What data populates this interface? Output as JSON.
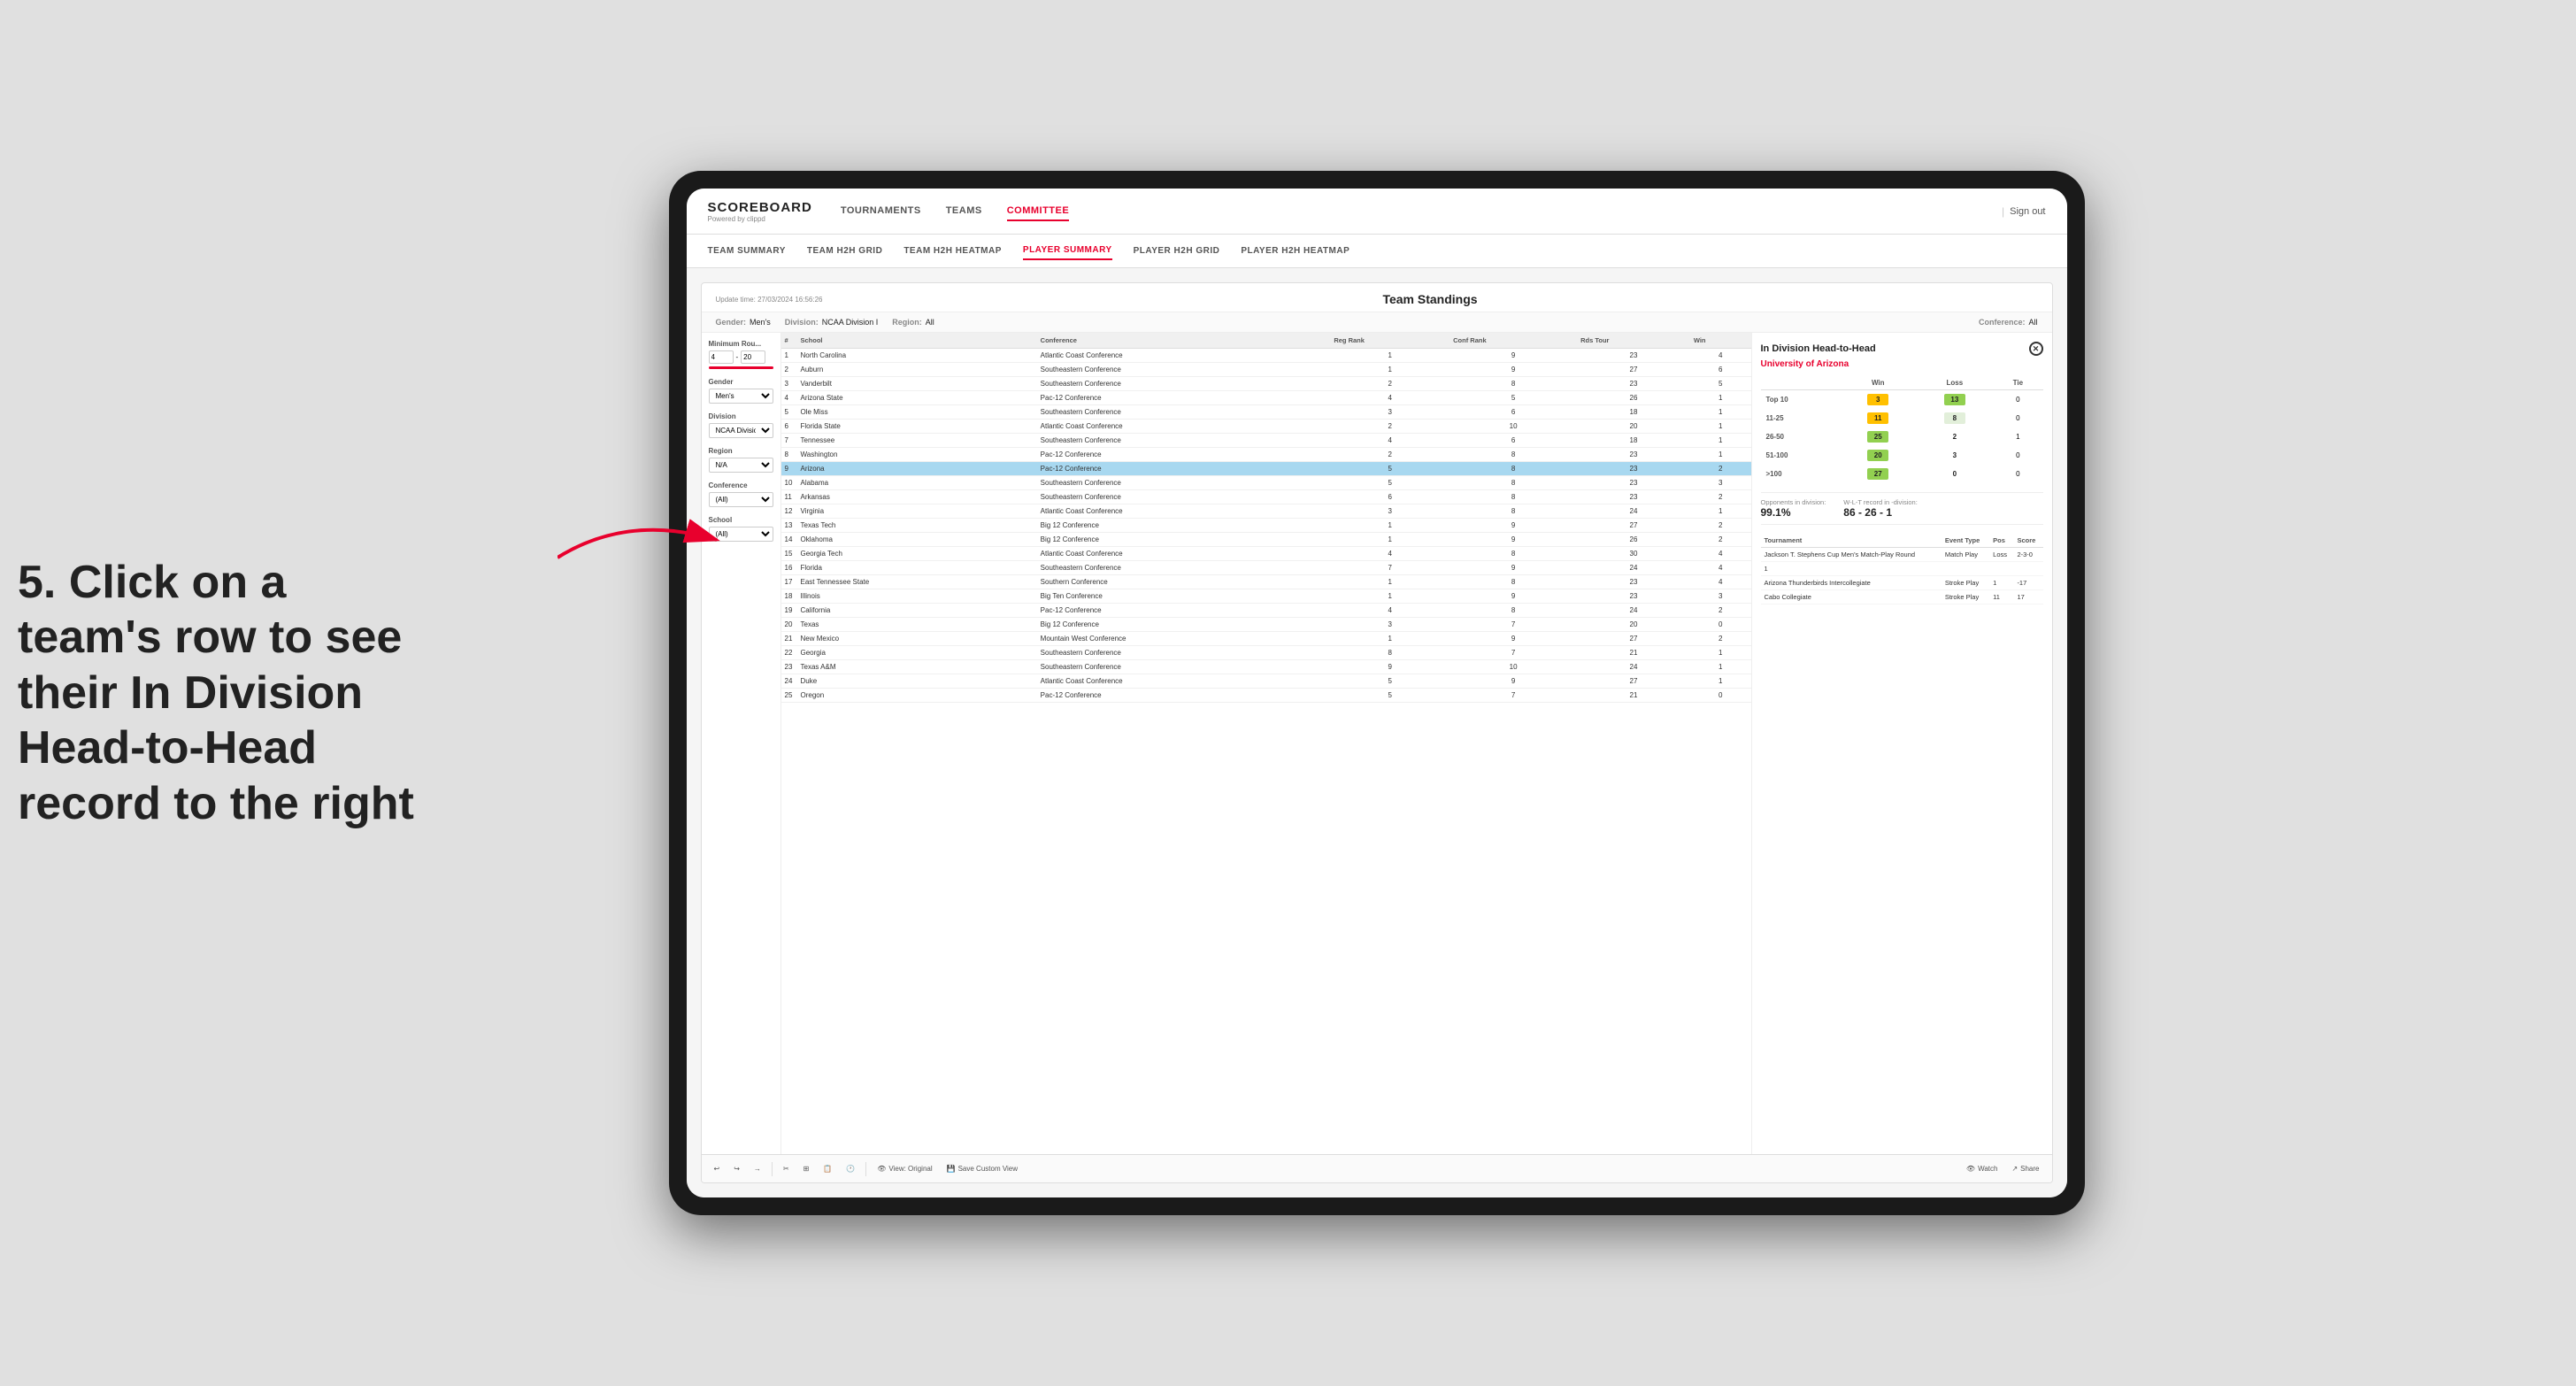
{
  "page": {
    "background_color": "#e0e0e0"
  },
  "annotation": {
    "text": "5. Click on a team's row to see their In Division Head-to-Head record to the right"
  },
  "top_nav": {
    "logo": "SCOREBOARD",
    "logo_sub": "Powered by clippd",
    "links": [
      "TOURNAMENTS",
      "TEAMS",
      "COMMITTEE"
    ],
    "active_link": "COMMITTEE",
    "sign_out": "Sign out"
  },
  "sub_nav": {
    "links": [
      "TEAM SUMMARY",
      "TEAM H2H GRID",
      "TEAM H2H HEATMAP",
      "PLAYER SUMMARY",
      "PLAYER H2H GRID",
      "PLAYER H2H HEATMAP"
    ],
    "active_link": "PLAYER SUMMARY"
  },
  "panel": {
    "title": "Team Standings",
    "update_time": "Update time:",
    "update_date": "27/03/2024 16:56:26",
    "filters": {
      "gender_label": "Gender:",
      "gender_value": "Men's",
      "division_label": "Division:",
      "division_value": "NCAA Division I",
      "region_label": "Region:",
      "region_value": "All",
      "conference_label": "Conference:",
      "conference_value": "All"
    },
    "sidebar": {
      "min_rounds_label": "Minimum Rou...",
      "min_rounds_value": "4",
      "min_rounds_max": "20",
      "gender_label": "Gender",
      "gender_options": [
        "Men's"
      ],
      "division_label": "Division",
      "division_options": [
        "NCAA Division I"
      ],
      "region_label": "Region",
      "region_options": [
        "N/A"
      ],
      "conference_label": "Conference",
      "conference_options": [
        "(All)"
      ],
      "school_label": "School",
      "school_options": [
        "(All)"
      ]
    },
    "table": {
      "headers": [
        "#",
        "School",
        "Conference",
        "Reg Rank",
        "Conf Rank",
        "Rds Tour",
        "Win"
      ],
      "rows": [
        {
          "num": "1",
          "school": "North Carolina",
          "conference": "Atlantic Coast Conference",
          "reg_rank": "1",
          "conf_rank": "9",
          "rds": "23",
          "win": "4"
        },
        {
          "num": "2",
          "school": "Auburn",
          "conference": "Southeastern Conference",
          "reg_rank": "1",
          "conf_rank": "9",
          "rds": "27",
          "win": "6"
        },
        {
          "num": "3",
          "school": "Vanderbilt",
          "conference": "Southeastern Conference",
          "reg_rank": "2",
          "conf_rank": "8",
          "rds": "23",
          "win": "5"
        },
        {
          "num": "4",
          "school": "Arizona State",
          "conference": "Pac-12 Conference",
          "reg_rank": "4",
          "conf_rank": "5",
          "rds": "26",
          "win": "1"
        },
        {
          "num": "5",
          "school": "Ole Miss",
          "conference": "Southeastern Conference",
          "reg_rank": "3",
          "conf_rank": "6",
          "rds": "18",
          "win": "1"
        },
        {
          "num": "6",
          "school": "Florida State",
          "conference": "Atlantic Coast Conference",
          "reg_rank": "2",
          "conf_rank": "10",
          "rds": "20",
          "win": "1"
        },
        {
          "num": "7",
          "school": "Tennessee",
          "conference": "Southeastern Conference",
          "reg_rank": "4",
          "conf_rank": "6",
          "rds": "18",
          "win": "1"
        },
        {
          "num": "8",
          "school": "Washington",
          "conference": "Pac-12 Conference",
          "reg_rank": "2",
          "conf_rank": "8",
          "rds": "23",
          "win": "1"
        },
        {
          "num": "9",
          "school": "Arizona",
          "conference": "Pac-12 Conference",
          "reg_rank": "5",
          "conf_rank": "8",
          "rds": "23",
          "win": "2",
          "selected": true
        },
        {
          "num": "10",
          "school": "Alabama",
          "conference": "Southeastern Conference",
          "reg_rank": "5",
          "conf_rank": "8",
          "rds": "23",
          "win": "3"
        },
        {
          "num": "11",
          "school": "Arkansas",
          "conference": "Southeastern Conference",
          "reg_rank": "6",
          "conf_rank": "8",
          "rds": "23",
          "win": "2"
        },
        {
          "num": "12",
          "school": "Virginia",
          "conference": "Atlantic Coast Conference",
          "reg_rank": "3",
          "conf_rank": "8",
          "rds": "24",
          "win": "1"
        },
        {
          "num": "13",
          "school": "Texas Tech",
          "conference": "Big 12 Conference",
          "reg_rank": "1",
          "conf_rank": "9",
          "rds": "27",
          "win": "2"
        },
        {
          "num": "14",
          "school": "Oklahoma",
          "conference": "Big 12 Conference",
          "reg_rank": "1",
          "conf_rank": "9",
          "rds": "26",
          "win": "2"
        },
        {
          "num": "15",
          "school": "Georgia Tech",
          "conference": "Atlantic Coast Conference",
          "reg_rank": "4",
          "conf_rank": "8",
          "rds": "30",
          "win": "4"
        },
        {
          "num": "16",
          "school": "Florida",
          "conference": "Southeastern Conference",
          "reg_rank": "7",
          "conf_rank": "9",
          "rds": "24",
          "win": "4"
        },
        {
          "num": "17",
          "school": "East Tennessee State",
          "conference": "Southern Conference",
          "reg_rank": "1",
          "conf_rank": "8",
          "rds": "23",
          "win": "4"
        },
        {
          "num": "18",
          "school": "Illinois",
          "conference": "Big Ten Conference",
          "reg_rank": "1",
          "conf_rank": "9",
          "rds": "23",
          "win": "3"
        },
        {
          "num": "19",
          "school": "California",
          "conference": "Pac-12 Conference",
          "reg_rank": "4",
          "conf_rank": "8",
          "rds": "24",
          "win": "2"
        },
        {
          "num": "20",
          "school": "Texas",
          "conference": "Big 12 Conference",
          "reg_rank": "3",
          "conf_rank": "7",
          "rds": "20",
          "win": "0"
        },
        {
          "num": "21",
          "school": "New Mexico",
          "conference": "Mountain West Conference",
          "reg_rank": "1",
          "conf_rank": "9",
          "rds": "27",
          "win": "2"
        },
        {
          "num": "22",
          "school": "Georgia",
          "conference": "Southeastern Conference",
          "reg_rank": "8",
          "conf_rank": "7",
          "rds": "21",
          "win": "1"
        },
        {
          "num": "23",
          "school": "Texas A&M",
          "conference": "Southeastern Conference",
          "reg_rank": "9",
          "conf_rank": "10",
          "rds": "24",
          "win": "1"
        },
        {
          "num": "24",
          "school": "Duke",
          "conference": "Atlantic Coast Conference",
          "reg_rank": "5",
          "conf_rank": "9",
          "rds": "27",
          "win": "1"
        },
        {
          "num": "25",
          "school": "Oregon",
          "conference": "Pac-12 Conference",
          "reg_rank": "5",
          "conf_rank": "7",
          "rds": "21",
          "win": "0"
        }
      ]
    },
    "h2h": {
      "title": "In Division Head-to-Head",
      "school": "University of Arizona",
      "col_win": "Win",
      "col_loss": "Loss",
      "col_tie": "Tie",
      "rows": [
        {
          "range": "Top 10",
          "win": "3",
          "loss": "13",
          "tie": "0",
          "win_class": "cell-orange",
          "loss_class": "cell-green"
        },
        {
          "range": "11-25",
          "win": "11",
          "loss": "8",
          "tie": "0",
          "win_class": "cell-orange",
          "loss_class": "cell-light"
        },
        {
          "range": "26-50",
          "win": "25",
          "loss": "2",
          "tie": "1",
          "win_class": "cell-green",
          "loss_class": "cell-white"
        },
        {
          "range": "51-100",
          "win": "20",
          "loss": "3",
          "tie": "0",
          "win_class": "cell-green",
          "loss_class": "cell-white"
        },
        {
          "range": ">100",
          "win": "27",
          "loss": "0",
          "tie": "0",
          "win_class": "cell-green",
          "loss_class": "cell-white"
        }
      ],
      "opponents_label": "Opponents in division:",
      "opponents_value": "99.1%",
      "record_label": "W-L-T record in -division:",
      "record_value": "86 - 26 - 1",
      "tournament_headers": [
        "Tournament",
        "Event Type",
        "Pos",
        "Score"
      ],
      "tournaments": [
        {
          "name": "Jackson T. Stephens Cup Men's Match-Play Round",
          "type": "Match Play",
          "pos": "Loss",
          "score": "2-3-0"
        },
        {
          "name": "1",
          "type": "",
          "pos": "",
          "score": ""
        },
        {
          "name": "Arizona Thunderbirds Intercollegiate",
          "type": "Stroke Play",
          "pos": "1",
          "score": "-17"
        },
        {
          "name": "Cabo Collegiate",
          "type": "Stroke Play",
          "pos": "11",
          "score": "17"
        }
      ]
    }
  },
  "toolbar": {
    "undo": "↩",
    "redo": "↪",
    "forward": "→",
    "view_original": "View: Original",
    "save_custom": "Save Custom View",
    "watch": "Watch",
    "share": "Share"
  }
}
